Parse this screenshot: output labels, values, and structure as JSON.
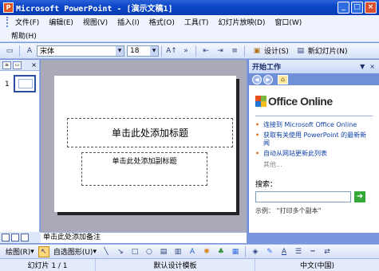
{
  "window": {
    "title": "Microsoft PowerPoint - [演示文稿1]",
    "app_icon": "P",
    "buttons": {
      "minimize": "_",
      "restore": "□",
      "close": "×"
    }
  },
  "menubar": {
    "items": [
      "文件(F)",
      "编辑(E)",
      "视图(V)",
      "插入(I)",
      "格式(O)",
      "工具(T)",
      "幻灯片放映(D)",
      "窗口(W)"
    ],
    "help": "帮助(H)"
  },
  "toolbar": {
    "font_name": "宋体",
    "font_size": "18",
    "design_label": "设计(S)",
    "new_slide_label": "新幻灯片(N)"
  },
  "left_panel": {
    "slide_number": "1"
  },
  "slide": {
    "title_placeholder": "单击此处添加标题",
    "subtitle_placeholder": "单击此处添加副标题"
  },
  "notes": {
    "placeholder": "单击此处添加备注"
  },
  "task_pane": {
    "title": "开始工作",
    "logo_text": "Office Online",
    "links": [
      "连接到 Microsoft Office Online",
      "获取有关使用 PowerPoint 的最新新闻",
      "自动从网站更新此列表"
    ],
    "more": "其他...",
    "search_label": "搜索：",
    "search_value": "",
    "example": "示例：  “打印多个副本”"
  },
  "drawing_toolbar": {
    "draw_label": "绘图(R)",
    "autoshapes_label": "自选图形(U)"
  },
  "statusbar": {
    "slide_info": "幻灯片 1 / 1",
    "template": "默认设计模板",
    "language": "中文(中国)"
  },
  "colors": {
    "titlebar": "#0a46c8",
    "slide_bg": "#a9a9b7",
    "link": "#0d3fa8",
    "bullet": "#e06f1b"
  }
}
